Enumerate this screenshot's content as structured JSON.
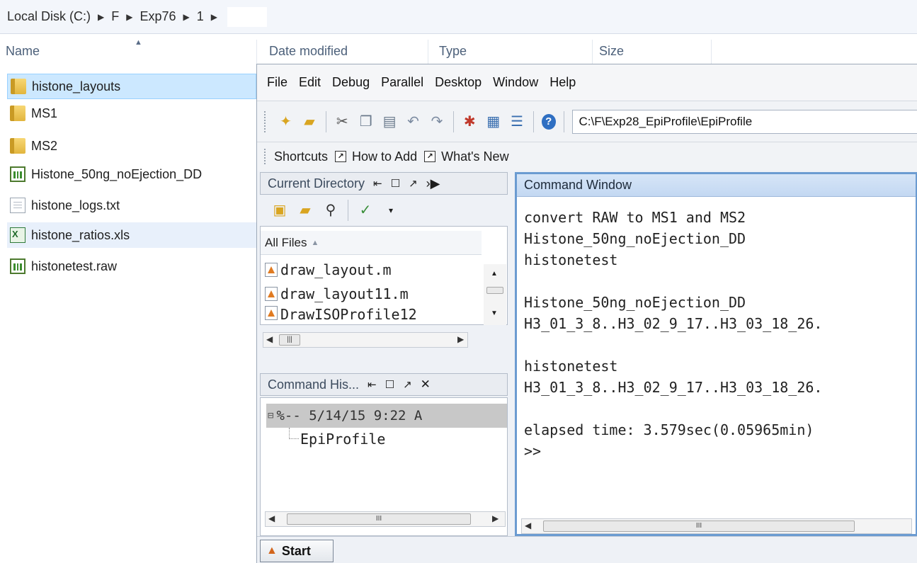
{
  "breadcrumb": {
    "items": [
      "Local Disk (C:)",
      "F",
      "Exp76",
      "1"
    ]
  },
  "columns": {
    "name": "Name",
    "date_modified": "Date modified",
    "type": "Type",
    "size": "Size"
  },
  "files": [
    {
      "name": "histone_layouts",
      "icon": "folder-icon",
      "state": "selected"
    },
    {
      "name": "MS1",
      "icon": "folder-icon",
      "state": ""
    },
    {
      "name": "MS2",
      "icon": "folder-icon",
      "state": ""
    },
    {
      "name": "Histone_50ng_noEjection_DD",
      "icon": "raw-file-icon",
      "state": ""
    },
    {
      "name": "histone_logs.txt",
      "icon": "text-file-icon",
      "state": ""
    },
    {
      "name": "histone_ratios.xls",
      "icon": "excel-file-icon",
      "state": "hover"
    },
    {
      "name": "histonetest.raw",
      "icon": "raw-file-icon",
      "state": ""
    }
  ],
  "matlab": {
    "menu": [
      "File",
      "Edit",
      "Debug",
      "Parallel",
      "Desktop",
      "Window",
      "Help"
    ],
    "current_folder_path": "C:\\F\\Exp28_EpiProfile\\EpiProfile",
    "shortcuts": {
      "label": "Shortcuts",
      "how_to_add": "How to Add",
      "whats_new": "What's New"
    },
    "current_directory": {
      "title": "Current Directory",
      "filter": "All Files",
      "files": [
        "draw_layout.m",
        "draw_layout11.m",
        "DrawISOProfile12"
      ]
    },
    "command_history": {
      "title": "Command His...",
      "group": "%-- 5/14/15   9:22 A",
      "entries": [
        "EpiProfile"
      ]
    },
    "command_window": {
      "title": "Command Window",
      "lines": [
        "convert RAW to MS1 and MS2",
        "Histone_50ng_noEjection_DD",
        "histonetest",
        "",
        "Histone_50ng_noEjection_DD",
        "H3_01_3_8..H3_02_9_17..H3_03_18_26.",
        "",
        "histonetest",
        "H3_01_3_8..H3_02_9_17..H3_03_18_26.",
        "",
        "elapsed time: 3.579sec(0.05965min)",
        ">>"
      ]
    },
    "start_label": "Start"
  },
  "colors": {
    "selection": "#cce8ff",
    "command_window_border": "#6b9bd1"
  }
}
